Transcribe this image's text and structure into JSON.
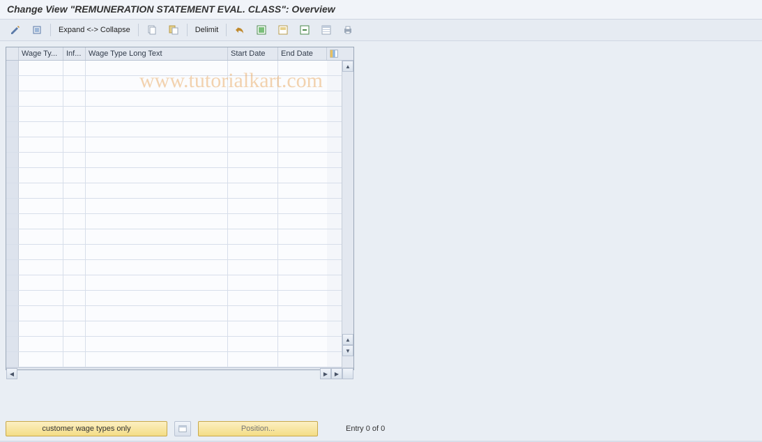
{
  "title": "Change View \"REMUNERATION STATEMENT EVAL. CLASS\": Overview",
  "toolbar": {
    "expand_collapse_label": "Expand <-> Collapse",
    "delimit_label": "Delimit"
  },
  "grid": {
    "columns": {
      "c1": "Wage Ty...",
      "c2": "Inf...",
      "c3": "Wage Type Long Text",
      "c4": "Start Date",
      "c5": "End Date"
    },
    "row_count": 20
  },
  "footer": {
    "customer_btn": "customer wage types only",
    "position_btn": "Position...",
    "entry_text": "Entry 0 of 0"
  },
  "watermark": "www.tutorialkart.com"
}
